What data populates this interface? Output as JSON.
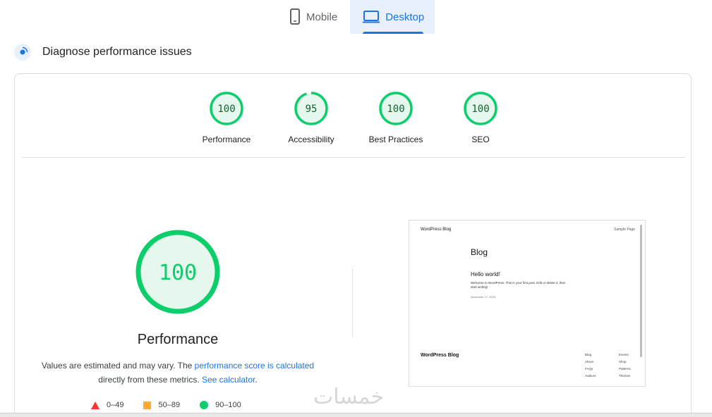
{
  "tabs": [
    {
      "label": "Mobile",
      "icon": "mobile-phone-icon",
      "active": false
    },
    {
      "label": "Desktop",
      "icon": "desktop-monitor-icon",
      "active": true
    }
  ],
  "diagnose": {
    "title": "Diagnose performance issues",
    "icon": "diagnose-icon"
  },
  "categories": [
    {
      "label": "Performance",
      "score": "100",
      "value": 100
    },
    {
      "label": "Accessibility",
      "score": "95",
      "value": 95
    },
    {
      "label": "Best Practices",
      "score": "100",
      "value": 100
    },
    {
      "label": "SEO",
      "score": "100",
      "value": 100
    }
  ],
  "main": {
    "score": "100",
    "title": "Performance",
    "note_prefix": "Values are estimated and may vary. The ",
    "note_link1": "performance score is calculated",
    "note_middle": " directly from these metrics. ",
    "note_link2": "See calculator",
    "note_suffix": "."
  },
  "legend": [
    {
      "label": "0–49",
      "shape": "triangle",
      "color": "#ff3333"
    },
    {
      "label": "50–89",
      "shape": "square",
      "color": "#ffaa33"
    },
    {
      "label": "90–100",
      "shape": "circle",
      "color": "#0cce6b"
    }
  ],
  "thumbnail": {
    "site_title": "WordPress Blog",
    "sample_page": "Sample Page",
    "heading": "Blog",
    "post_title": "Hello world!",
    "post_excerpt": "Welcome to WordPress. This is your first post. Edit or delete it, then start writing!",
    "post_date": "November 17, 2023",
    "footer_title": "WordPress Blog",
    "footer_links": [
      "Blog",
      "Events",
      "About",
      "Shop",
      "FAQs",
      "Patterns",
      "Authors",
      "Themes"
    ]
  },
  "watermark": "خمسات",
  "colors": {
    "pass": "#0cce6b",
    "pass_fill": "#e6f8ee",
    "pass_text": "#0d652d",
    "accent": "#1a73e8"
  }
}
